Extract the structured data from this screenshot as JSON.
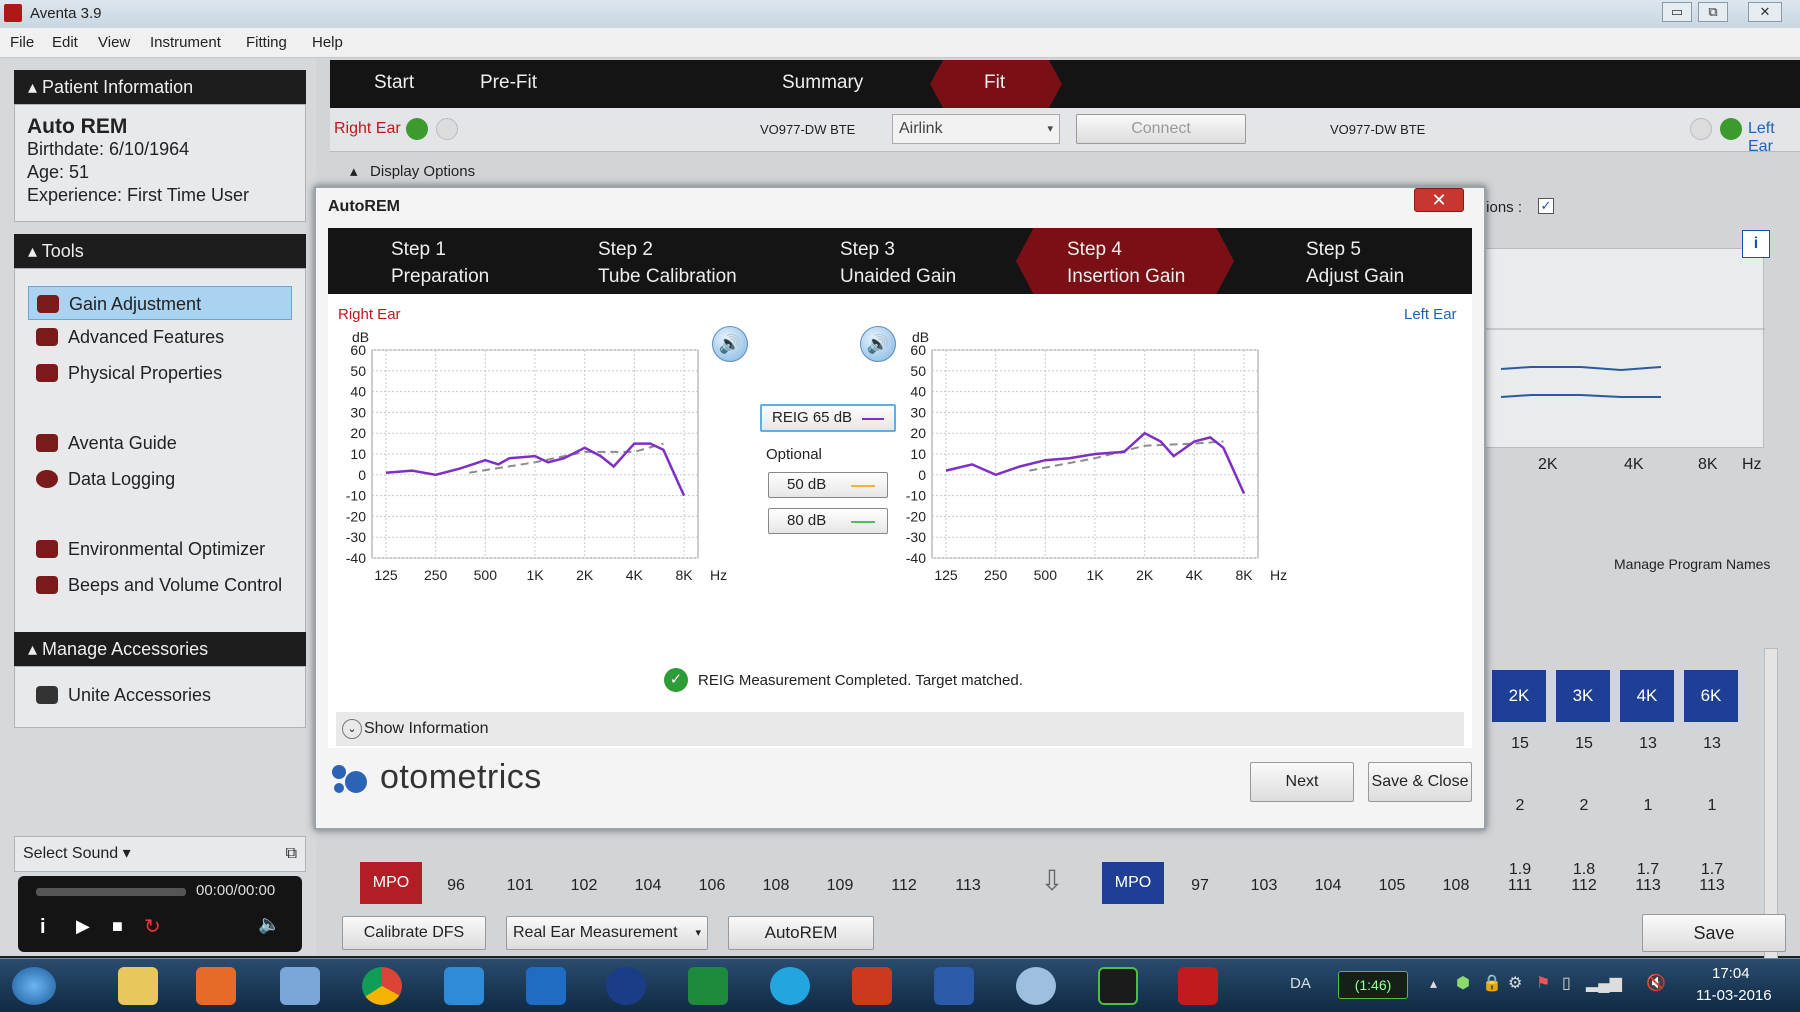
{
  "window": {
    "title": "Aventa 3.9",
    "controls": [
      "▭",
      "⧉",
      "✕"
    ]
  },
  "menu": [
    "File",
    "Edit",
    "View",
    "Instrument",
    "Fitting",
    "Help"
  ],
  "patient": {
    "section": "Patient Information",
    "name": "Auto REM",
    "birthdate": "Birthdate: 6/10/1964",
    "age": "Age: 51",
    "experience": "Experience: First Time User"
  },
  "tools": {
    "section": "Tools",
    "items": [
      "Gain Adjustment",
      "Advanced Features",
      "Physical Properties",
      "Aventa Guide",
      "Data Logging",
      "Environmental Optimizer",
      "Beeps and Volume Control"
    ]
  },
  "accessories": {
    "section": "Manage Accessories",
    "items": [
      "Unite Accessories"
    ]
  },
  "select_sound": {
    "label": "Select Sound",
    "time": "00:00/00:00"
  },
  "main_tabs": [
    "Start",
    "Pre-Fit",
    "Fit",
    "Summary"
  ],
  "ear_bar": {
    "right_ear": "Right Ear",
    "left_ear": "Left Ear",
    "right_device": "VO977-DW BTE",
    "left_device": "VO977-DW BTE",
    "interface": "Airlink",
    "connect": "Connect"
  },
  "display_options": "Display Options",
  "options_partial": "tions :",
  "dialog": {
    "title": "AutoREM",
    "close": "✕",
    "steps": [
      {
        "n": "Step 1",
        "name": "Preparation"
      },
      {
        "n": "Step 2",
        "name": "Tube Calibration"
      },
      {
        "n": "Step 3",
        "name": "Unaided Gain"
      },
      {
        "n": "Step 4",
        "name": "Insertion Gain"
      },
      {
        "n": "Step 5",
        "name": "Adjust Gain"
      }
    ],
    "right_label": "Right Ear",
    "left_label": "Left Ear",
    "legend_main": "REIG 65 dB",
    "optional": "Optional",
    "legend_50": "50 dB",
    "legend_80": "80 dB",
    "status": "REIG Measurement Completed. Target matched.",
    "show_info": "Show Information",
    "next": "Next",
    "save_close": "Save & Close",
    "logo": "otometrics"
  },
  "chart_data": [
    {
      "type": "line",
      "title": "Right Ear",
      "ylabel": "dB",
      "xlabel": "Hz",
      "ylim": [
        -40,
        60
      ],
      "yticks": [
        "60",
        "50",
        "40",
        "30",
        "20",
        "10",
        "0",
        "-10",
        "-20",
        "-30",
        "-40"
      ],
      "xticks": [
        "125",
        "250",
        "500",
        "1K",
        "2K",
        "4K",
        "8K"
      ],
      "series": [
        {
          "name": "REIG 65 dB",
          "color": "#7d2fc8",
          "x": [
            125,
            180,
            250,
            350,
            500,
            600,
            700,
            1000,
            1200,
            1500,
            2000,
            2500,
            3000,
            4000,
            5000,
            6000,
            8000
          ],
          "values": [
            1,
            2,
            0,
            3,
            7,
            5,
            8,
            9,
            6,
            8,
            13,
            9,
            4,
            15,
            15,
            12,
            -10
          ]
        },
        {
          "name": "Target",
          "color": "#8c8c8c",
          "x": [
            400,
            1000,
            2000,
            4000,
            6000
          ],
          "values": [
            1,
            6,
            11,
            11,
            15
          ]
        }
      ]
    },
    {
      "type": "line",
      "title": "Left Ear",
      "ylabel": "dB",
      "xlabel": "Hz",
      "ylim": [
        -40,
        60
      ],
      "yticks": [
        "60",
        "50",
        "40",
        "30",
        "20",
        "10",
        "0",
        "-10",
        "-20",
        "-30",
        "-40"
      ],
      "xticks": [
        "125",
        "250",
        "500",
        "1K",
        "2K",
        "4K",
        "8K"
      ],
      "series": [
        {
          "name": "REIG 65 dB",
          "color": "#7d2fc8",
          "x": [
            125,
            180,
            250,
            350,
            500,
            700,
            1000,
            1500,
            2000,
            2500,
            3000,
            4000,
            5000,
            6000,
            8000
          ],
          "values": [
            2,
            5,
            0,
            4,
            7,
            8,
            10,
            11,
            20,
            16,
            9,
            16,
            18,
            13,
            -9
          ]
        },
        {
          "name": "Target",
          "color": "#8c8c8c",
          "x": [
            400,
            1000,
            2000,
            4000,
            6000
          ],
          "values": [
            2,
            8,
            14,
            15,
            16
          ]
        }
      ]
    }
  ],
  "background_graph": {
    "ticks": [
      "2K",
      "4K",
      "8K",
      "Hz"
    ]
  },
  "program_names": "Manage Program Names",
  "right_table": {
    "headers": [
      "2K",
      "3K",
      "4K",
      "6K"
    ],
    "rows": [
      [
        "15",
        "15",
        "13",
        "13"
      ],
      [
        "2",
        "2",
        "1",
        "1"
      ],
      [
        "1.9",
        "1.8",
        "1.7",
        "1.7"
      ]
    ]
  },
  "mpo_left": {
    "label": "MPO",
    "values": [
      "96",
      "101",
      "102",
      "104",
      "106",
      "108",
      "109",
      "112",
      "113"
    ]
  },
  "mpo_right": {
    "label": "MPO",
    "values": [
      "97",
      "103",
      "104",
      "105",
      "108",
      "111",
      "112",
      "113",
      "113"
    ]
  },
  "bottom_buttons": {
    "calibrate": "Calibrate DFS",
    "rem": "Real Ear Measurement",
    "autorem": "AutoREM",
    "save": "Save"
  },
  "taskbar": {
    "lang": "DA",
    "battery": "(1:46)",
    "time": "17:04",
    "date": "11-03-2016"
  }
}
